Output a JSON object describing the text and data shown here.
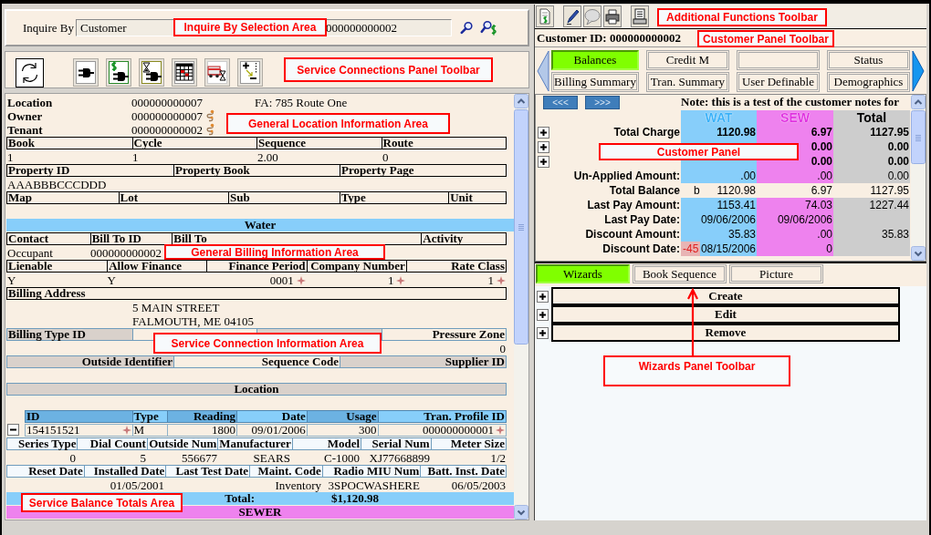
{
  "inquire": {
    "label": "Inquire By",
    "by_value": "Customer",
    "id_value": "000000000002",
    "callout": "Inquire By Selection Area"
  },
  "connections_toolbar": {
    "callout": "Service Connections Panel Toolbar"
  },
  "location": {
    "callout": "General Location Information Area",
    "fields": [
      {
        "label": "Location",
        "value": "000000000007",
        "link_icon": false,
        "note": "FA: 785 Route One"
      },
      {
        "label": "Owner",
        "value": "000000000007",
        "link_icon": true
      },
      {
        "label": "Tenant",
        "value": "000000000002",
        "link_icon": true
      }
    ],
    "grids": [
      [
        {
          "label": "Book",
          "value": "1"
        },
        {
          "label": "Cycle",
          "value": "1"
        },
        {
          "label": "Sequence",
          "value": "2.00"
        },
        {
          "label": "Route",
          "value": "0"
        }
      ],
      [
        {
          "label": "Property ID",
          "value": "AAABBBCCCDDD"
        },
        {
          "label": "Property Book"
        },
        {
          "label": "Property Page"
        }
      ],
      [
        {
          "label": "Map"
        },
        {
          "label": "Lot"
        },
        {
          "label": "Sub"
        },
        {
          "label": "Type"
        },
        {
          "label": "Unit"
        }
      ]
    ]
  },
  "services": [
    {
      "title": "Water",
      "color": "#87cefa",
      "billing": {
        "callout": "General Billing Information Area",
        "grids": [
          [
            {
              "label": "Contact",
              "value": "Occupant"
            },
            {
              "label": "Bill To ID",
              "value": "000000000002"
            },
            {
              "label": "Bill To"
            },
            {
              "label": "Activity"
            }
          ],
          [
            {
              "label": "Lienable",
              "value": "Y",
              "flag": false
            },
            {
              "label": "Allow Finance",
              "value": "Y",
              "flag": false
            },
            {
              "label": "Finance Period",
              "value": "0001",
              "flag": true
            },
            {
              "label": "Company Number",
              "value": "1",
              "flag": true
            },
            {
              "label": "Rate Class",
              "value": "1",
              "flag": true
            }
          ]
        ],
        "address": {
          "label": "Billing Address",
          "lines": [
            "5 MAIN STREET",
            "FALMOUTH, ME 04105"
          ]
        }
      },
      "connection": {
        "callout": "Service Connection Information Area",
        "grids": [
          [
            {
              "label": "Billing Type ID",
              "shaded": true
            },
            {
              "shaded": false
            },
            {
              "shaded": true
            },
            {
              "label": "Pressure Zone",
              "value": "0",
              "shaded": false
            }
          ],
          [
            {
              "label": "Outside Identifier",
              "shaded": true
            },
            {
              "label": "Sequence Code",
              "shaded": false
            },
            {
              "label": "Supplier ID",
              "shaded": true
            }
          ]
        ]
      },
      "meters": {
        "title": "Location",
        "columns": [
          "ID",
          "Type",
          "Reading",
          "Date",
          "Usage",
          "Tran. Profile ID"
        ],
        "rows": [
          {
            "expanded": true,
            "cells": [
              {
                "text": "154151521",
                "flag": true
              },
              {
                "text": "M",
                "flag": false
              },
              {
                "text": "1800",
                "flag": false
              },
              {
                "text": "09/01/2006",
                "flag": false
              },
              {
                "text": "300",
                "flag": false
              },
              {
                "text": "000000000001",
                "flag": true
              }
            ],
            "details": [
              [
                {
                  "label": "Series Type",
                  "value": "0"
                },
                {
                  "label": "Dial Count",
                  "value": "5"
                },
                {
                  "label": "Outside Num",
                  "value": "556677"
                },
                {
                  "label": "Manufacturer",
                  "value": "SEARS"
                },
                {
                  "label": "Model",
                  "value": "C-1000"
                },
                {
                  "label": "Serial Num",
                  "value": "XJ77668899"
                },
                {
                  "label": "Meter Size",
                  "value": "1/2"
                }
              ],
              [
                {
                  "label": "Reset Date"
                },
                {
                  "label": "Installed Date",
                  "value": "01/05/2001"
                },
                {
                  "label": "Last Test Date"
                },
                {
                  "label": "Maint. Code",
                  "value": "Inventory"
                },
                {
                  "label": "Radio MIU Num",
                  "value": "3SPOCWASHERE"
                },
                {
                  "label": "Batt. Inst. Date",
                  "value": "06/05/2003"
                }
              ]
            ]
          }
        ]
      },
      "total": {
        "label": "Total:",
        "amount": "$1,120.98",
        "callout": "Service Balance Totals Area"
      }
    },
    {
      "title": "SEWER",
      "color": "#ee82ee"
    }
  ],
  "functions_toolbar": {
    "callout": "Additional Functions Toolbar"
  },
  "customer": {
    "heading": "Customer ID: 000000000002"
  },
  "customer_tabs": {
    "callout": "Customer Panel Toolbar",
    "tabs": [
      {
        "label": "Balances",
        "selected": true
      },
      {
        "label": "Credit M",
        "selected": false
      },
      {
        "selected": false
      },
      {
        "label": "Status",
        "selected": false
      },
      {
        "label": "Billing Summary",
        "selected": false
      },
      {
        "label": "Tran. Summary",
        "selected": false
      },
      {
        "label": "User Definable",
        "selected": false
      },
      {
        "label": "Demographics",
        "selected": false
      }
    ]
  },
  "customer_panel": {
    "callout": "Customer Panel",
    "pager": [
      "<<<",
      ">>>"
    ],
    "note": "Note: this is a test of the customer notes for",
    "columns": [
      {
        "label": "WAT",
        "color": "#87cefa"
      },
      {
        "label": "SEW",
        "color": "#ee82ee"
      },
      {
        "label": "Total",
        "color": "#cdcdcd"
      }
    ],
    "rows": [
      {
        "kind": "charge",
        "label": "Total Charge",
        "expanded": false,
        "wat": "1120.98",
        "sew": "6.97",
        "total": "1127.95"
      },
      {
        "kind": "charge",
        "expanded": false,
        "sew": "0.00",
        "total": "0.00"
      },
      {
        "kind": "charge",
        "expanded": false,
        "sew": "0.00",
        "total": "0.00"
      },
      {
        "kind": "amount",
        "label": "Un-Applied Amount:",
        "wat": ".00",
        "sew": ".00",
        "total": "0.00"
      },
      {
        "kind": "balance",
        "label": "Total Balance",
        "prefix": "b",
        "wat": "1120.98",
        "sew": "6.97",
        "total": "1127.95"
      },
      {
        "kind": "amount",
        "label": "Last Pay Amount:",
        "wat": "1153.41",
        "sew": "74.03",
        "total": "1227.44"
      },
      {
        "kind": "amount",
        "label": "Last Pay Date:",
        "wat": "09/06/2006",
        "sew": "09/06/2006"
      },
      {
        "kind": "amount",
        "label": "Discount Amount:",
        "wat": "35.83",
        "sew": ".00",
        "total": "35.83"
      },
      {
        "kind": "amount",
        "label": "Discount Date:",
        "badge": "-45",
        "wat": "08/15/2006",
        "sew": "0"
      }
    ]
  },
  "wizards": {
    "callout": "Wizards Panel Toolbar",
    "tabs": [
      {
        "label": "Wizards",
        "selected": true
      },
      {
        "label": "Book Sequence",
        "selected": false
      },
      {
        "label": "Picture",
        "selected": false
      }
    ],
    "items": [
      {
        "label": "Create",
        "expanded": false
      },
      {
        "label": "Edit",
        "expanded": false
      },
      {
        "label": "Remove",
        "expanded": false
      }
    ]
  }
}
